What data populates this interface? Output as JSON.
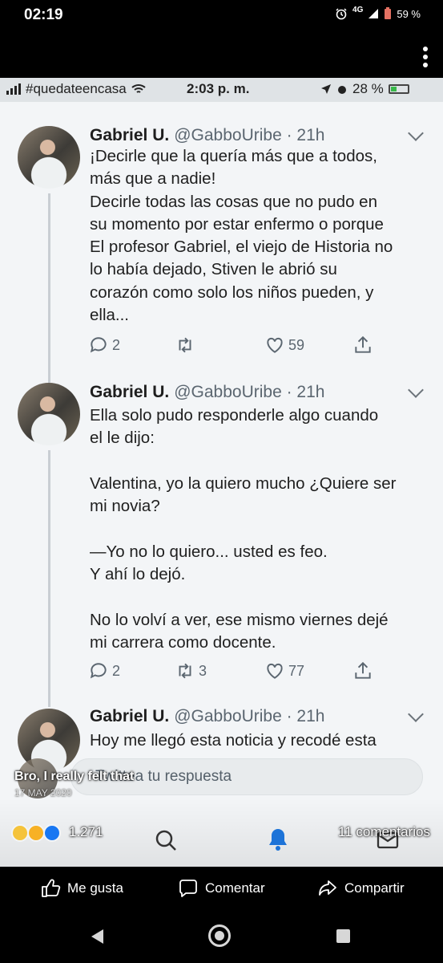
{
  "outer_status": {
    "time": "02:19",
    "network": "4G",
    "battery": "59 %"
  },
  "inner_status": {
    "carrier": "#quedateencasa",
    "time": "2:03 p. m.",
    "battery": "28 %"
  },
  "tweets": [
    {
      "name": "Gabriel U.",
      "handle": "@GabboUribe · 21h",
      "text": "¡Decirle que la quería más que a todos,\nmás que a nadie!\nDecirle todas las cosas que no pudo en\nsu momento por estar enfermo o porque\nEl profesor Gabriel, el viejo de Historia no\nlo había dejado, Stiven le abrió su\ncorazón como solo los niños pueden, y\nella...",
      "replies": "2",
      "retweets": "",
      "likes": "59"
    },
    {
      "name": "Gabriel U.",
      "handle": "@GabboUribe · 21h",
      "text": "Ella solo pudo responderle algo cuando\nel le dijo:\n\nValentina, yo la quiero mucho ¿Quiere ser\nmi novia?\n\n—Yo no lo quiero... usted es feo.\nY ahí lo dejó.\n\nNo lo volví a ver, ese mismo viernes dejé\nmi carrera como docente.",
      "replies": "2",
      "retweets": "3",
      "likes": "77"
    },
    {
      "name": "Gabriel U.",
      "handle": "@GabboUribe · 21h",
      "text": "Hoy me llegó esta noticia y recodé esta"
    }
  ],
  "reply_placeholder": "Twittea tu respuesta",
  "overlay": {
    "caption": "Bro, I really felt that",
    "date": "17 MAY 2020"
  },
  "reactions": {
    "count": "1.271",
    "comments": "11 comentarios"
  },
  "fb_actions": {
    "like": "Me gusta",
    "comment": "Comentar",
    "share": "Compartir"
  },
  "icons": [
    "alarm-icon",
    "signal-icon",
    "battery-icon",
    "wifi-icon",
    "kebab-icon",
    "reply-icon",
    "retweet-icon",
    "heart-icon",
    "share-icon",
    "search-icon",
    "bell-icon",
    "mail-icon",
    "like-icon",
    "comment-icon",
    "fb-share-icon"
  ]
}
